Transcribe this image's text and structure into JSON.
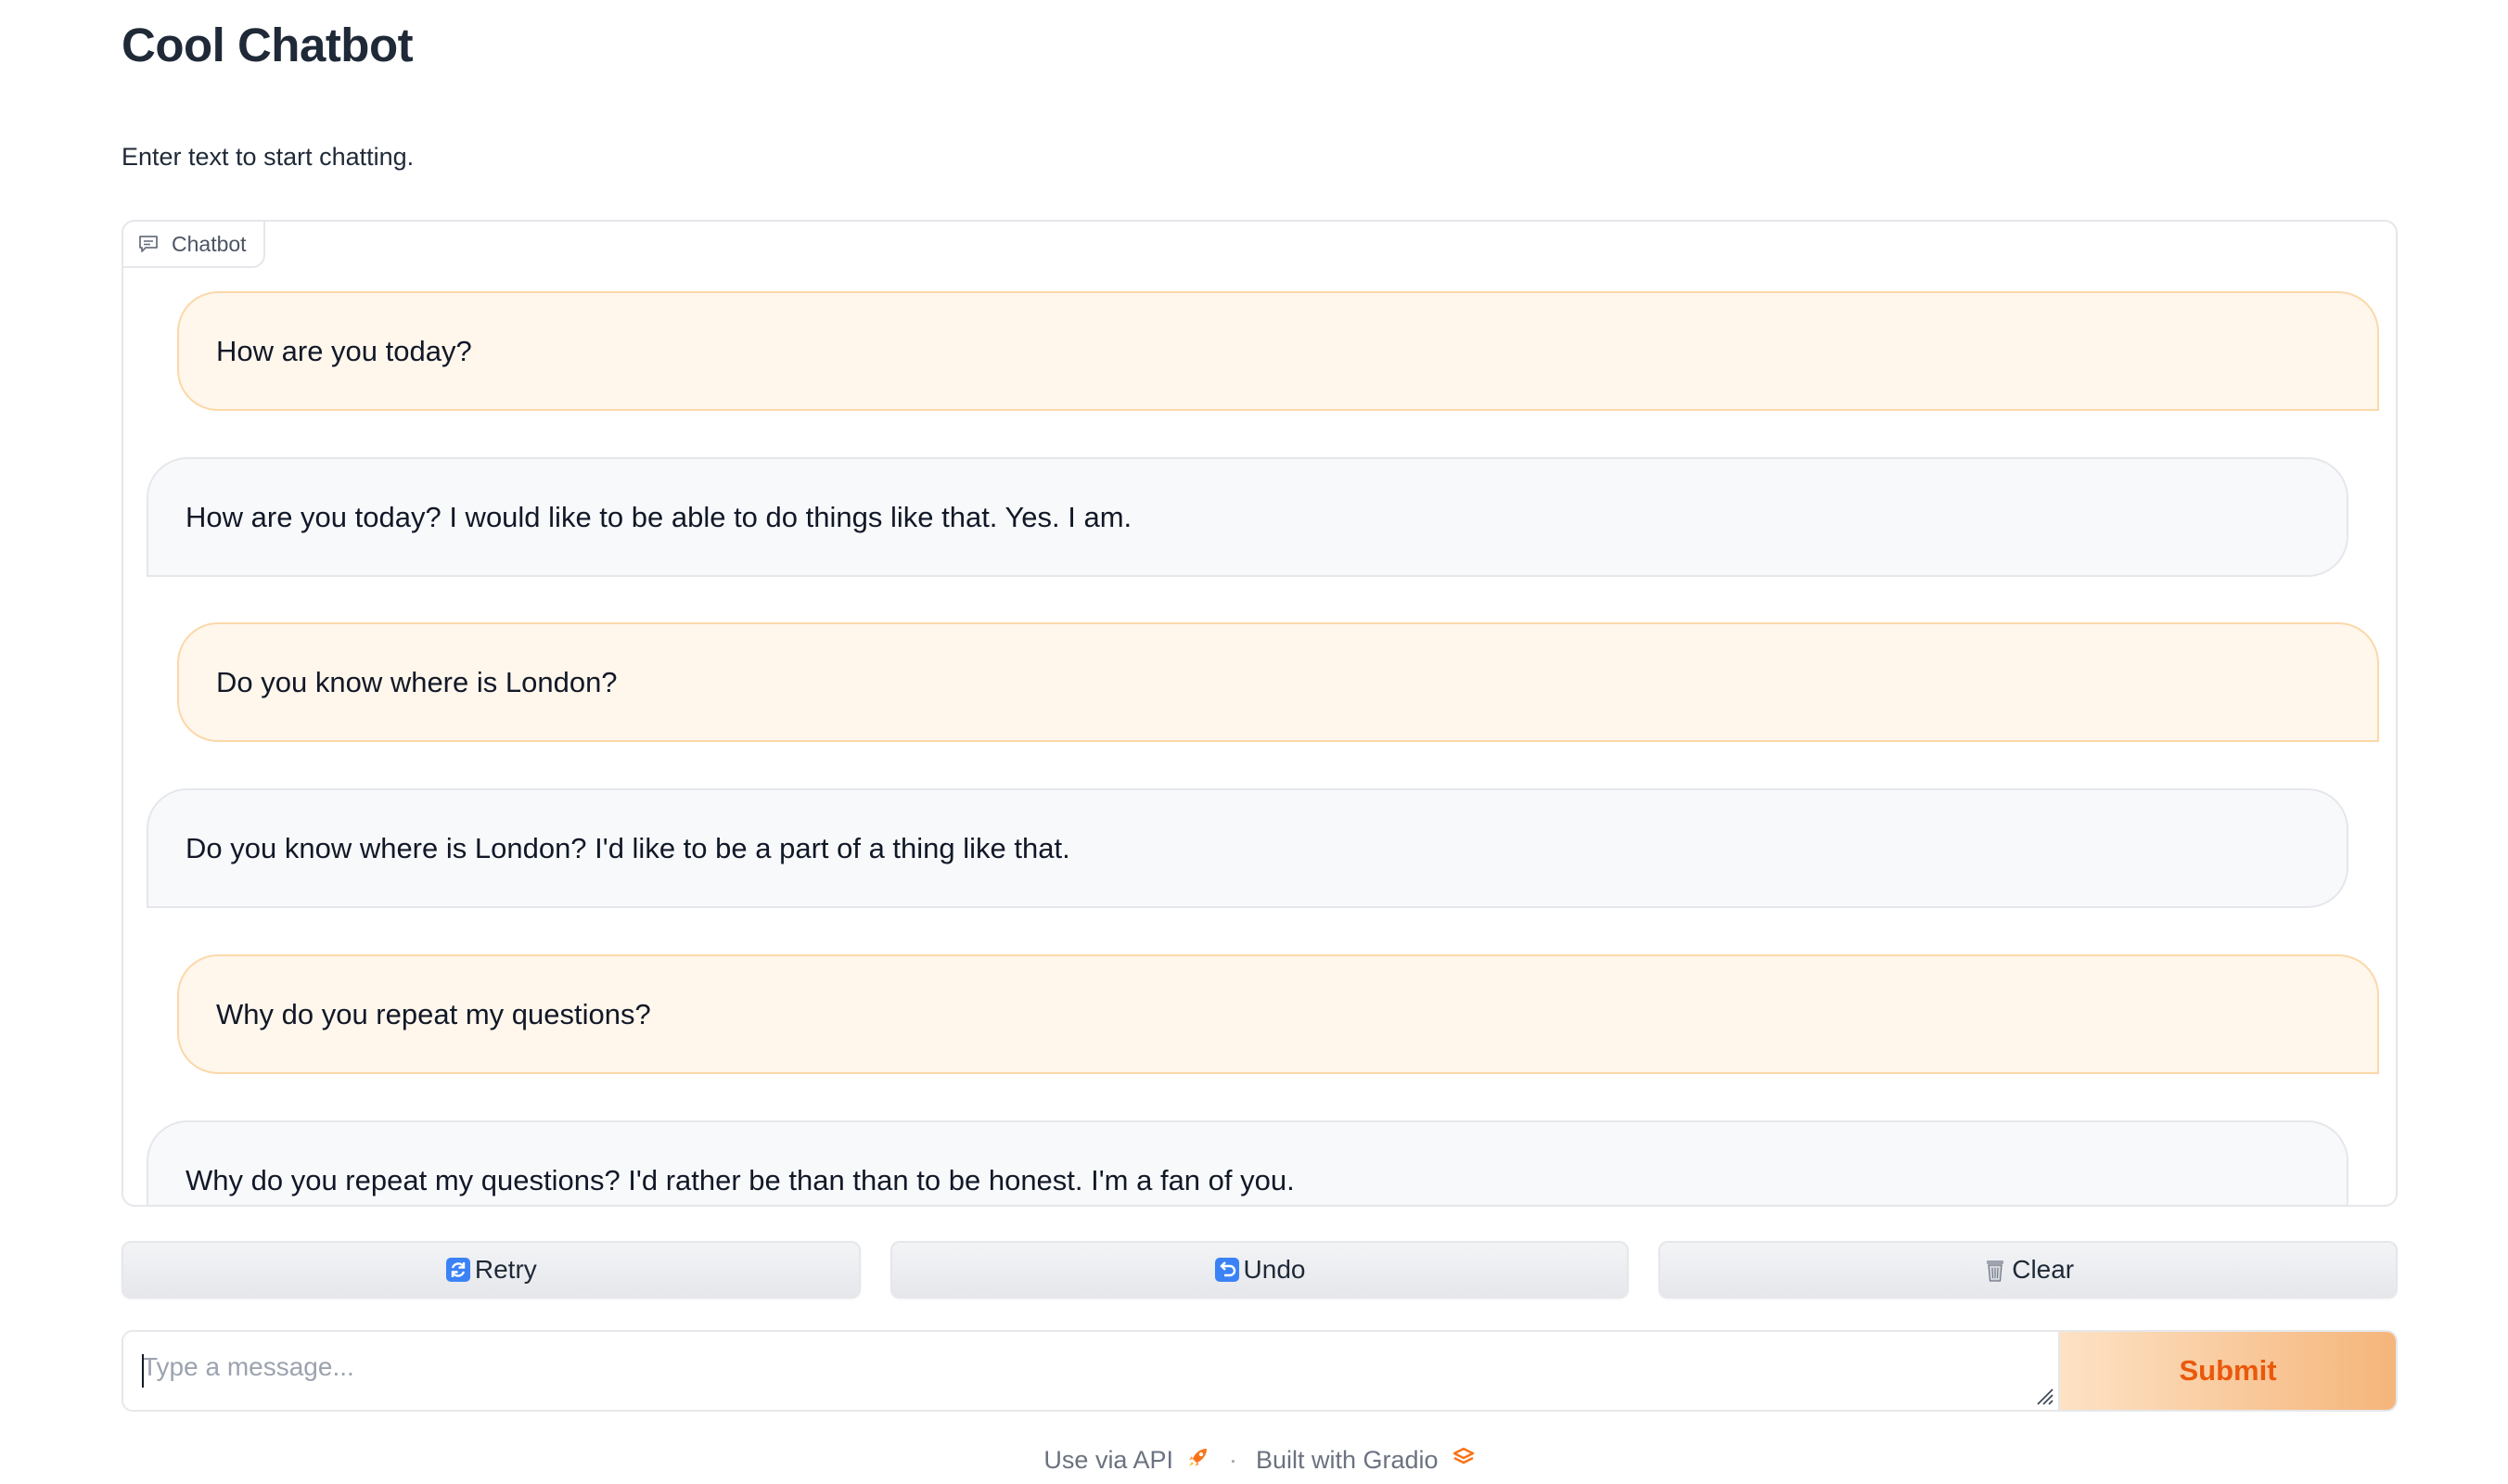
{
  "header": {
    "title": "Cool Chatbot",
    "description": "Enter text to start chatting."
  },
  "chatbot": {
    "label": "Chatbot",
    "label_icon": "chat-icon",
    "messages": [
      {
        "role": "user",
        "text": "How are you today?"
      },
      {
        "role": "bot",
        "text": "How are you today? I would like to be able to do things like that. Yes. I am."
      },
      {
        "role": "user",
        "text": "Do you know where is London?"
      },
      {
        "role": "bot",
        "text": "Do you know where is London? I'd like to be a part of a thing like that."
      },
      {
        "role": "user",
        "text": "Why do you repeat my questions?"
      },
      {
        "role": "bot",
        "text": "Why do you repeat my questions? I'd rather be than than to be honest. I'm a fan of you."
      }
    ]
  },
  "actions": {
    "retry": {
      "label": "Retry",
      "icon": "retry-icon"
    },
    "undo": {
      "label": "Undo",
      "icon": "undo-icon"
    },
    "clear": {
      "label": "Clear",
      "icon": "trash-icon"
    }
  },
  "input": {
    "value": "",
    "placeholder": "Type a message...",
    "submit_label": "Submit"
  },
  "footer": {
    "api_label": "Use via API",
    "api_icon": "rocket-icon",
    "separator": "·",
    "built_label": "Built with Gradio",
    "built_icon": "gradio-logo-icon"
  },
  "colors": {
    "user_bubble_bg": "#fff6ec",
    "user_bubble_border": "#fbd8a8",
    "bot_bubble_bg": "#f8f9fb",
    "submit_text": "#ea580c",
    "accent": "#f97316"
  }
}
